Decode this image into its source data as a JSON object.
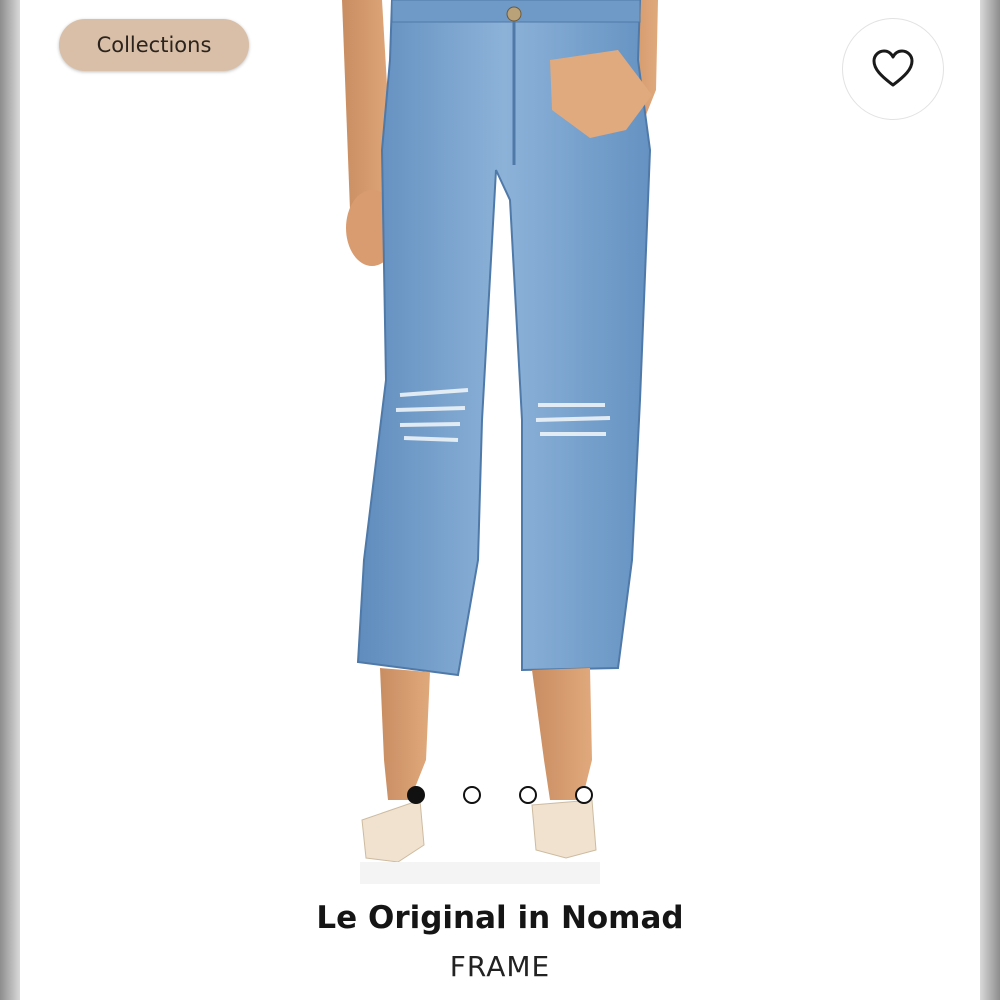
{
  "header": {
    "collections_label": "Collections",
    "favorite_icon": "heart-outline-icon"
  },
  "gallery": {
    "image_subject": "light-wash distressed straight-leg jeans with nude heels",
    "slide_count": 4,
    "active_slide": 1
  },
  "product": {
    "name": "Le Original in Nomad",
    "brand": "FRAME"
  },
  "colors": {
    "chip_background": "#d9bfa7",
    "denim": "#7ea7d0",
    "text": "#151515"
  }
}
